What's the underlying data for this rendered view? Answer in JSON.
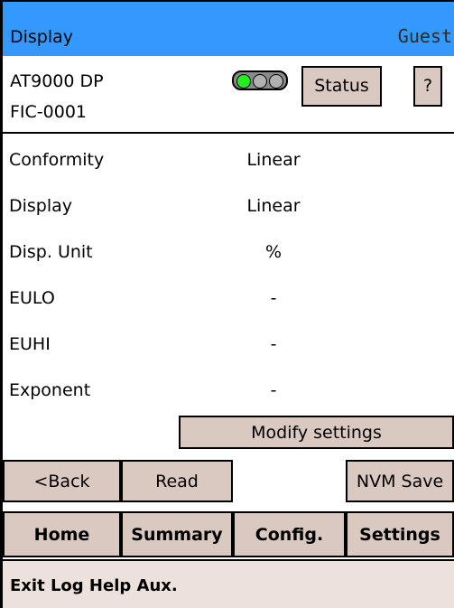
{
  "header": {
    "title": "Display",
    "user": "Guest"
  },
  "device": {
    "model": "AT9000 DP",
    "tag": "FIC-0001",
    "status_label": "Status",
    "help_label": "?",
    "leds": [
      "#22ee22",
      "#b0b0b0",
      "#b0b0b0"
    ]
  },
  "params": [
    {
      "label": "Conformity",
      "value": "Linear"
    },
    {
      "label": "Display",
      "value": "Linear"
    },
    {
      "label": "Disp. Unit",
      "value": "%"
    },
    {
      "label": "EULO",
      "value": "-"
    },
    {
      "label": "EUHI",
      "value": "-"
    },
    {
      "label": "Exponent",
      "value": "-"
    }
  ],
  "modify_label": "Modify settings",
  "actions": {
    "back": "<Back",
    "read": "Read",
    "nvm_save": "NVM Save"
  },
  "nav": {
    "home": "Home",
    "summary": "Summary",
    "config": "Config.",
    "settings": "Settings"
  },
  "menu": "Exit Log Help Aux."
}
